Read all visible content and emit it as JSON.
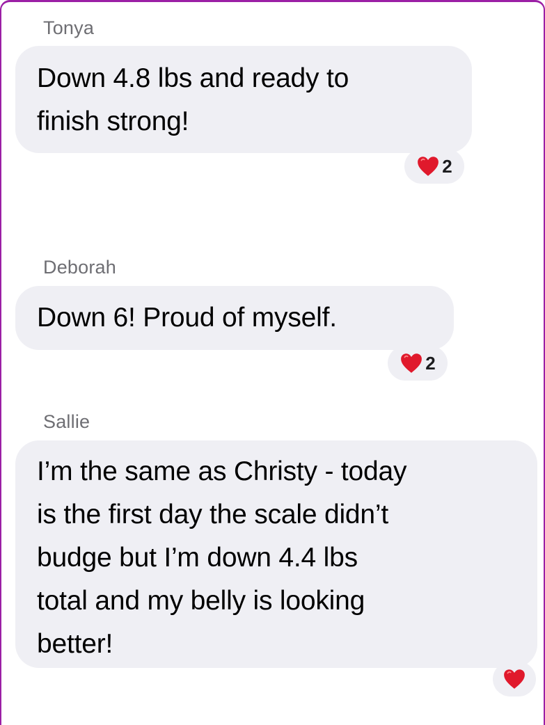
{
  "colors": {
    "bubble_bg": "#efeff4",
    "sender_text": "#6e6e73",
    "message_text": "#000000",
    "heart": "#e0192c",
    "frame_border": "#9b1fa5"
  },
  "messages": [
    {
      "sender": "Tonya",
      "lines": [
        "Down 4.8 lbs and ready to",
        "finish strong!"
      ],
      "reaction": {
        "icon": "heart-icon",
        "count": "2"
      }
    },
    {
      "sender": "Deborah",
      "lines": [
        "Down 6!  Proud of myself."
      ],
      "reaction": {
        "icon": "heart-icon",
        "count": "2"
      }
    },
    {
      "sender": "Sallie",
      "lines": [
        "I’m the same as Christy - today",
        "is the first day the scale didn’t",
        "budge but I’m down 4.4 lbs",
        "total and my belly is looking",
        "better!"
      ],
      "reaction": {
        "icon": "heart-icon",
        "count": ""
      }
    }
  ]
}
